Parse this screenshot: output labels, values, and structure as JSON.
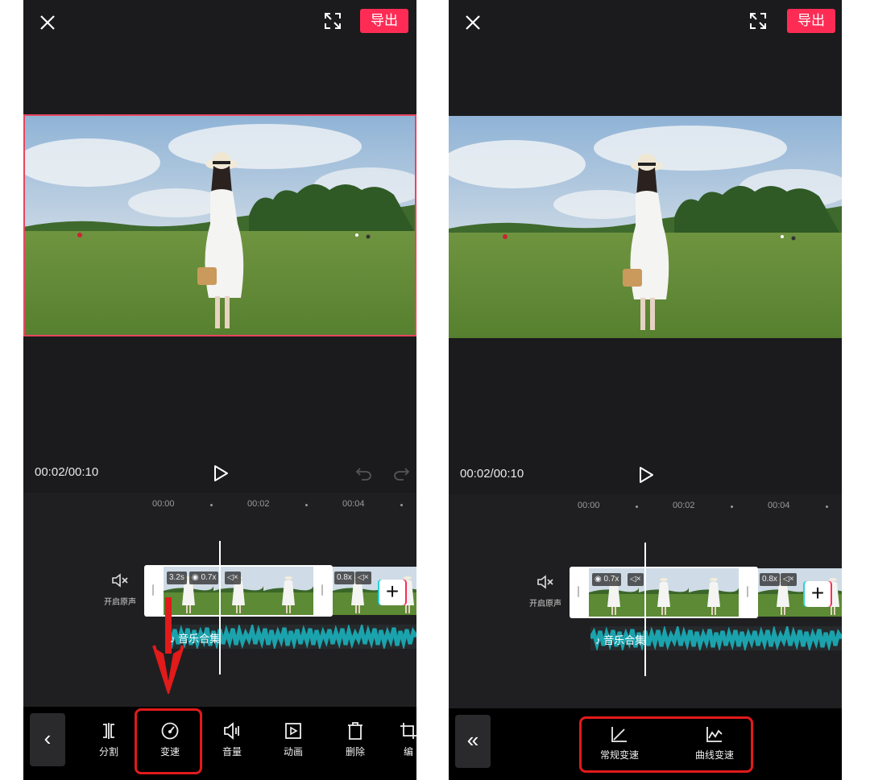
{
  "common": {
    "export_label": "导出",
    "timecode": "00:02/00:10",
    "ruler_ticks": [
      "00:00",
      "00:02",
      "00:04"
    ],
    "mute_label": "开启原声",
    "audio_track_name": "音乐合集",
    "clip_next_speed": "0.8x",
    "accent_color": "#fe2c55",
    "highlight_color": "#e11a1a",
    "audio_color": "#1aa3ad"
  },
  "left_panel": {
    "clip_duration": "3.2s",
    "clip_speed": "0.7x",
    "toolbar": [
      {
        "label": "分割",
        "icon": "split-icon"
      },
      {
        "label": "变速",
        "icon": "speed-icon"
      },
      {
        "label": "音量",
        "icon": "volume-icon"
      },
      {
        "label": "动画",
        "icon": "animation-icon"
      },
      {
        "label": "删除",
        "icon": "delete-icon"
      },
      {
        "label": "编",
        "icon": "edit-icon"
      }
    ]
  },
  "right_panel": {
    "clip_speed": "0.7x",
    "toolbar": [
      {
        "label": "常规变速",
        "icon": "normal-speed-icon"
      },
      {
        "label": "曲线变速",
        "icon": "curve-speed-icon"
      }
    ]
  }
}
